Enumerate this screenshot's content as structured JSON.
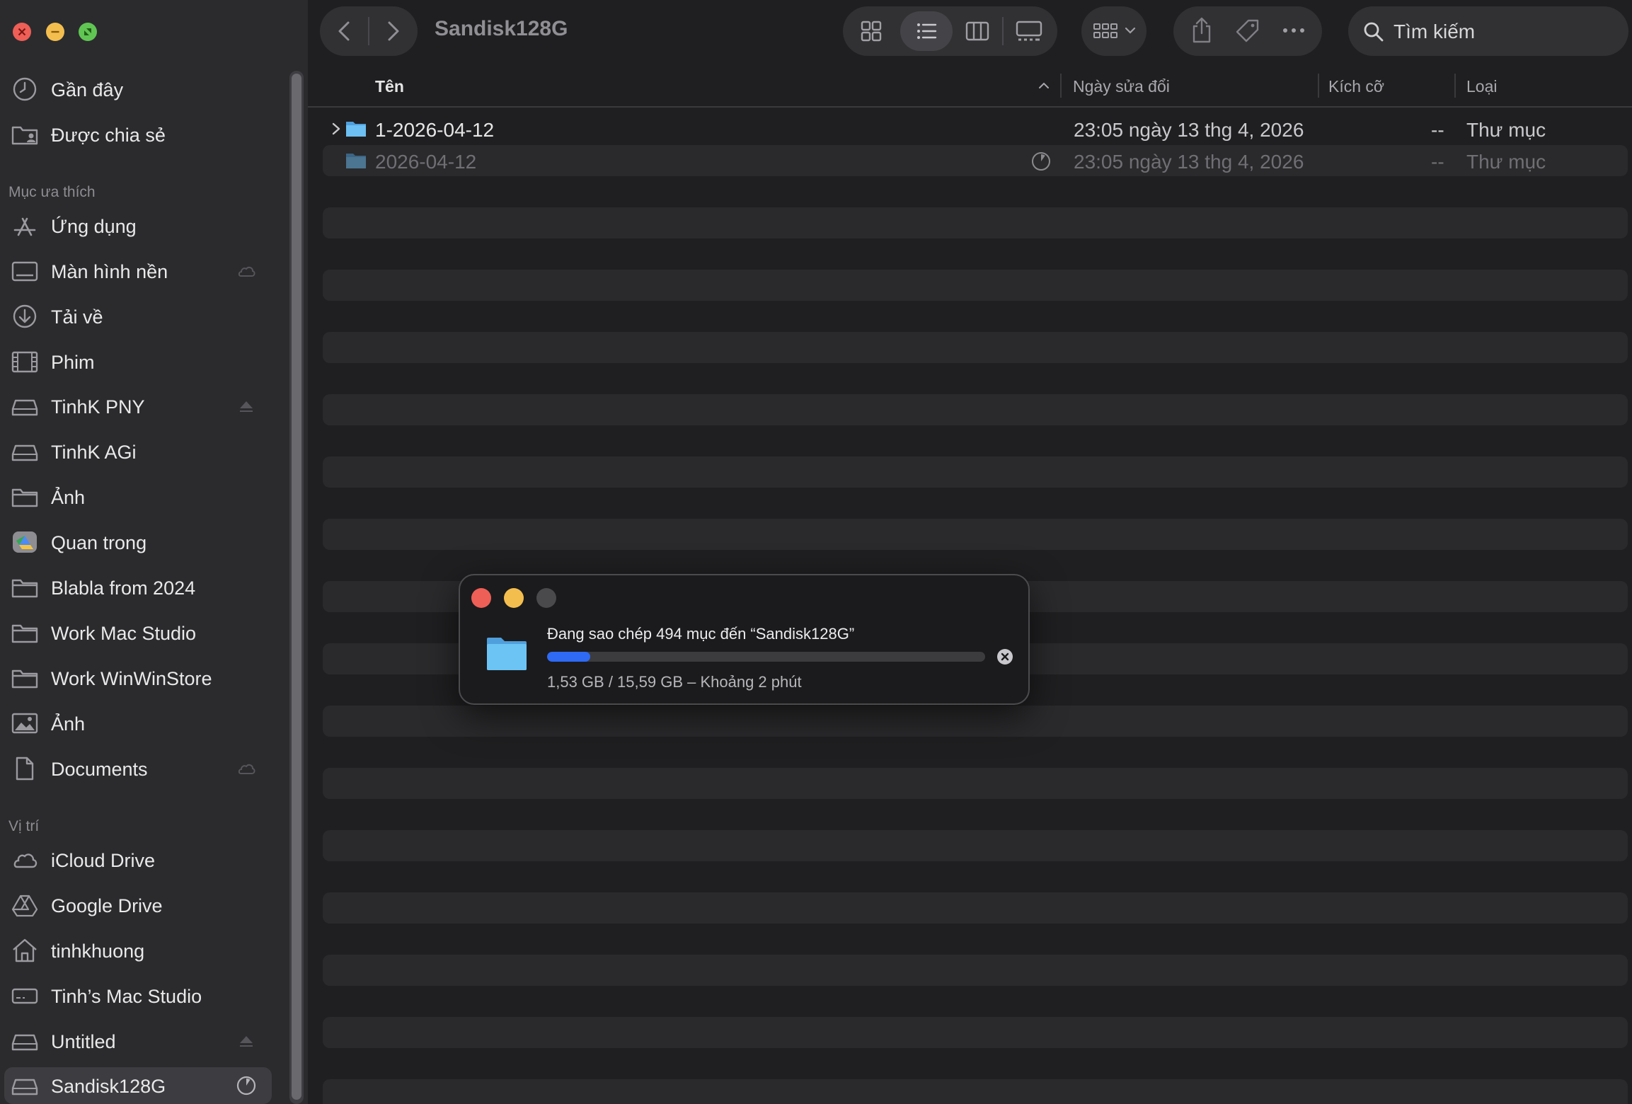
{
  "window": {
    "title": "Sandisk128G"
  },
  "sidebar": {
    "items_top": [
      {
        "label": "Gần đây",
        "icon": "clock-icon"
      },
      {
        "label": "Được chia sẻ",
        "icon": "shared-folder-icon"
      }
    ],
    "favorites_title": "Mục ưa thích",
    "favorites": [
      {
        "label": "Ứng dụng",
        "icon": "applications-icon"
      },
      {
        "label": "Màn hình nền",
        "icon": "desktop-icon",
        "trail": "cloud-icon"
      },
      {
        "label": "Tải về",
        "icon": "download-icon"
      },
      {
        "label": "Phim",
        "icon": "film-icon"
      },
      {
        "label": "TinhK PNY",
        "icon": "drive-icon",
        "trail": "eject-icon"
      },
      {
        "label": "TinhK AGi",
        "icon": "drive-icon"
      },
      {
        "label": "Ảnh",
        "icon": "folder-icon"
      },
      {
        "label": "Quan trong",
        "icon": "google-drive-folder-icon"
      },
      {
        "label": "Blabla from 2024",
        "icon": "folder-icon"
      },
      {
        "label": "Work Mac Studio",
        "icon": "folder-icon"
      },
      {
        "label": "Work WinWinStore",
        "icon": "folder-icon"
      },
      {
        "label": "Ảnh",
        "icon": "photo-icon"
      },
      {
        "label": "Documents",
        "icon": "document-icon",
        "trail": "cloud-icon"
      }
    ],
    "locations_title": "Vị trí",
    "locations": [
      {
        "label": "iCloud Drive",
        "icon": "cloud-icon"
      },
      {
        "label": "Google Drive",
        "icon": "google-drive-icon"
      },
      {
        "label": "tinhkhuong",
        "icon": "home-icon"
      },
      {
        "label": "Tinh’s Mac Studio",
        "icon": "computer-icon"
      },
      {
        "label": "Untitled",
        "icon": "drive-icon",
        "trail": "eject-icon"
      },
      {
        "label": "Sandisk128G",
        "icon": "drive-icon",
        "trail": "progress-pie-icon",
        "selected": true
      }
    ]
  },
  "toolbar": {
    "search_placeholder": "Tìm kiếm",
    "views": [
      "icon-view-icon",
      "list-view-icon",
      "column-view-icon",
      "gallery-view-icon"
    ],
    "active_view": "list-view-icon"
  },
  "columns": {
    "name": "Tên",
    "date": "Ngày sửa đổi",
    "size": "Kích cỡ",
    "kind": "Loại"
  },
  "files": [
    {
      "name": "1-2026-04-12",
      "date": "23:05 ngày 13 thg 4, 2026",
      "size": "--",
      "kind": "Thư mục",
      "expandable": true,
      "dimmed": false
    },
    {
      "name": "2026-04-12",
      "date": "23:05 ngày 13 thg 4, 2026",
      "size": "--",
      "kind": "Thư mục",
      "expandable": false,
      "dimmed": true
    }
  ],
  "copy_dialog": {
    "message": "Đang sao chép 494 mục đến “Sandisk128G”",
    "detail": "1,53 GB / 15,59 GB – Khoảng 2 phút",
    "progress": 0.098
  },
  "colors": {
    "accent": "#2e6af4",
    "close": "#ee5f57",
    "minimize": "#f4be4f",
    "zoom": "#61c554",
    "folder": "#5eb4ee"
  }
}
